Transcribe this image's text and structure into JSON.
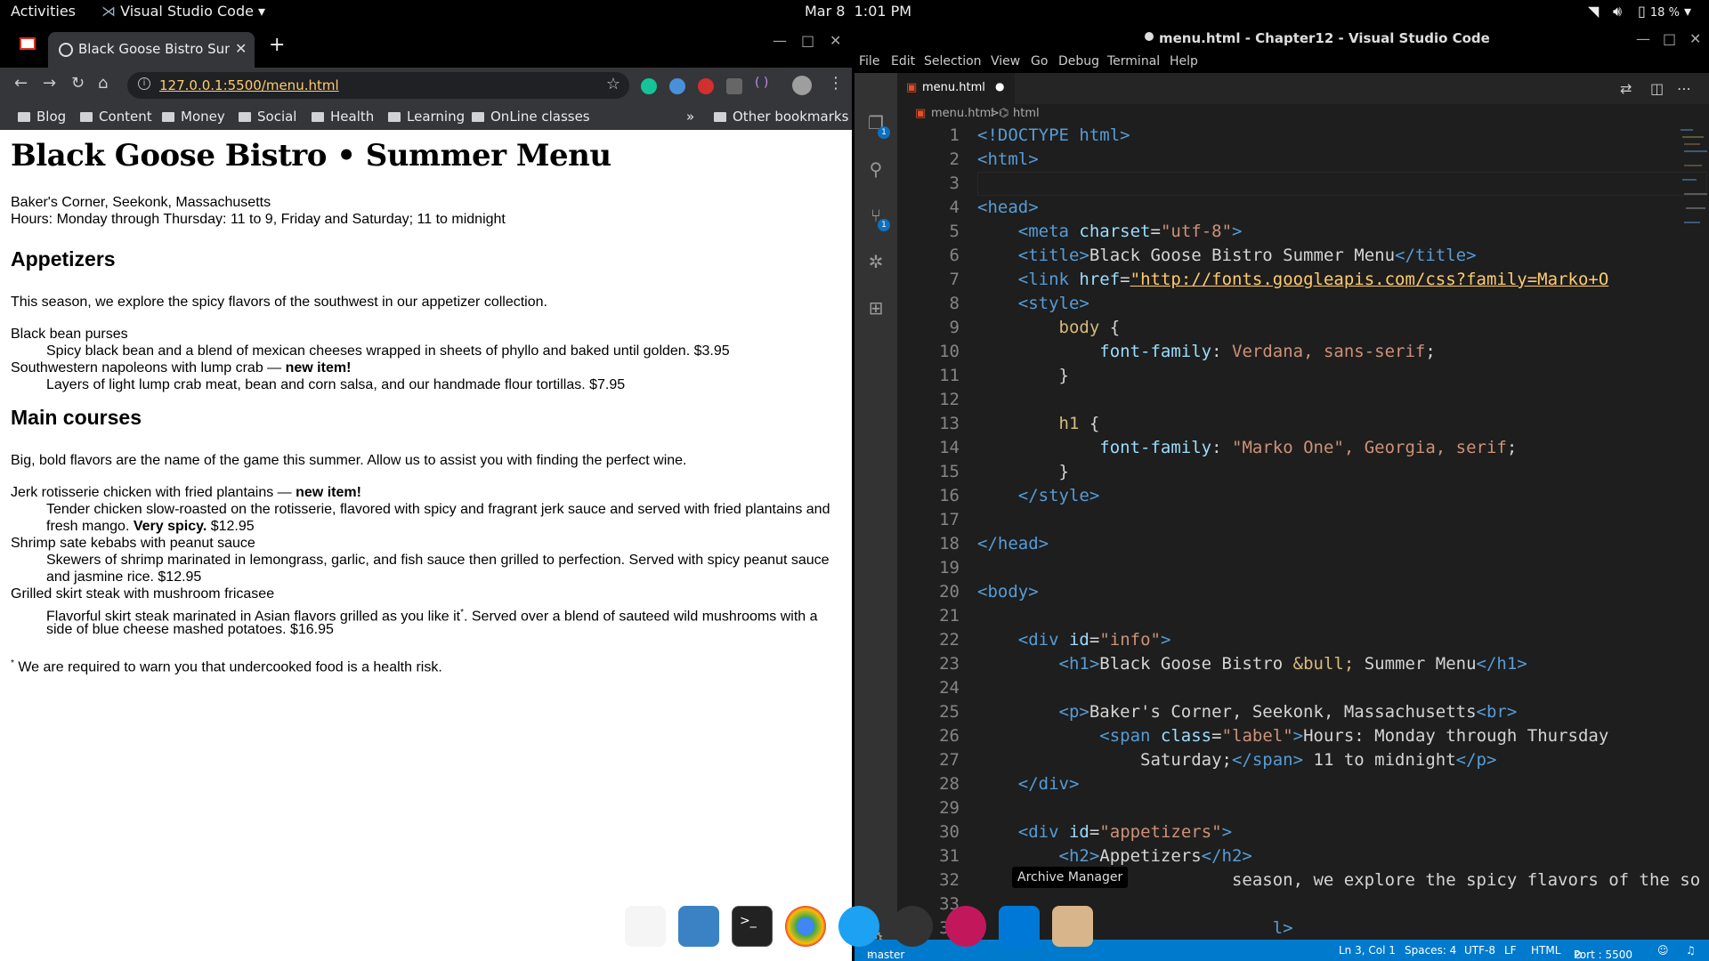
{
  "topbar": {
    "activities": "Activities",
    "app": "Visual Studio Code",
    "date": "Mar 8",
    "time": "1:01 PM",
    "battery": "18 %"
  },
  "browser": {
    "tab_title": "Black Goose Bistro Summ",
    "url": "127.0.0.1:5500/menu.html",
    "bookmarks": [
      "Blog",
      "Content",
      "Money",
      "Social",
      "Health",
      "Learning",
      "OnLine classes"
    ],
    "overflow": "»",
    "other_bookmarks": "Other bookmarks"
  },
  "page": {
    "h1": "Black Goose Bistro • Summer Menu",
    "address": "Baker's Corner, Seekonk, Massachusetts",
    "hours": "Hours: Monday through Thursday: 11 to 9, Friday and Saturday; 11 to midnight",
    "appetizers_heading": "Appetizers",
    "appetizers_intro": "This season, we explore the spicy flavors of the southwest in our appetizer collection.",
    "app1_name": "Black bean purses",
    "app1_desc": "Spicy black bean and a blend of mexican cheeses wrapped in sheets of phyllo and baked until golden. $3.95",
    "app2_name": "Southwestern napoleons with lump crab — ",
    "app2_new": "new item!",
    "app2_desc": "Layers of light lump crab meat, bean and corn salsa, and our handmade flour tortillas. $7.95",
    "main_heading": "Main courses",
    "main_intro": "Big, bold flavors are the name of the game this summer. Allow us to assist you with finding the perfect wine.",
    "main1_name": "Jerk rotisserie chicken with fried plantains — ",
    "main1_new": "new item!",
    "main1_desc1": "Tender chicken slow-roasted on the rotisserie, flavored with spicy and fragrant jerk sauce and served with fried plantains and",
    "main1_desc2a": "fresh mango. ",
    "main1_desc2b": "Very spicy.",
    "main1_desc2c": " $12.95",
    "main2_name": "Shrimp sate kebabs with peanut sauce",
    "main2_desc1": "Skewers of shrimp marinated in lemongrass, garlic, and fish sauce then grilled to perfection. Served with spicy peanut sauce",
    "main2_desc2": "and jasmine rice. $12.95",
    "main3_name": "Grilled skirt steak with mushroom fricasee",
    "main3_desc1a": "Flavorful skirt steak marinated in Asian flavors grilled as you like it",
    "main3_desc1b": "*",
    "main3_desc1c": ". Served over a blend of sauteed wild mushrooms with a",
    "main3_desc2": "side of blue cheese mashed potatoes. $16.95",
    "footnote_mark": "*",
    "footnote": " We are required to warn you that undercooked food is a health risk."
  },
  "vscode": {
    "title": "menu.html - Chapter12 - Visual Studio Code",
    "menu": [
      "File",
      "Edit",
      "Selection",
      "View",
      "Go",
      "Debug",
      "Terminal",
      "Help"
    ],
    "tab": "menu.html",
    "breadcrumb_file": "menu.html",
    "breadcrumb_sep": ">",
    "breadcrumb_node": "html",
    "badge_explorer": "1",
    "badge_scm": "1",
    "tooltip": "Archive Manager",
    "status": {
      "branch": "master",
      "position": "Ln 3, Col 1",
      "spaces": "Spaces: 4",
      "encoding": "UTF-8",
      "eol": "LF",
      "language": "HTML",
      "port": "Port : 5500"
    },
    "code_lines": [
      [
        [
          "tag",
          "<!DOCTYPE html>"
        ]
      ],
      [
        [
          "tag",
          "<html>"
        ]
      ],
      [],
      [
        [
          "tag",
          "<head>"
        ]
      ],
      [
        [
          "t",
          "    "
        ],
        [
          "tag",
          "<meta "
        ],
        [
          "attr",
          "charset"
        ],
        [
          "t",
          "="
        ],
        [
          "str",
          "\"utf-8\""
        ],
        [
          "tag",
          ">"
        ]
      ],
      [
        [
          "t",
          "    "
        ],
        [
          "tag",
          "<title>"
        ],
        [
          "t",
          "Black Goose Bistro Summer Menu"
        ],
        [
          "tag",
          "</title>"
        ]
      ],
      [
        [
          "t",
          "    "
        ],
        [
          "tag",
          "<link "
        ],
        [
          "attr",
          "href"
        ],
        [
          "t",
          "="
        ],
        [
          "url",
          "\"http://fonts.googleapis.com/css?family=Marko+O"
        ]
      ],
      [
        [
          "t",
          "    "
        ],
        [
          "tag",
          "<style>"
        ]
      ],
      [
        [
          "t",
          "        "
        ],
        [
          "sel",
          "body"
        ],
        [
          "t",
          " {"
        ]
      ],
      [
        [
          "t",
          "            "
        ],
        [
          "prop",
          "font-family"
        ],
        [
          "t",
          ": "
        ],
        [
          "str",
          "Verdana, sans-serif"
        ],
        [
          "t",
          ";"
        ]
      ],
      [
        [
          "t",
          "        }"
        ]
      ],
      [],
      [
        [
          "t",
          "        "
        ],
        [
          "sel",
          "h1"
        ],
        [
          "t",
          " {"
        ]
      ],
      [
        [
          "t",
          "            "
        ],
        [
          "prop",
          "font-family"
        ],
        [
          "t",
          ": "
        ],
        [
          "str",
          "\"Marko One\", Georgia, serif"
        ],
        [
          "t",
          ";"
        ]
      ],
      [
        [
          "t",
          "        }"
        ]
      ],
      [
        [
          "t",
          "    "
        ],
        [
          "tag",
          "</style>"
        ]
      ],
      [],
      [
        [
          "tag",
          "</head>"
        ]
      ],
      [],
      [
        [
          "tag",
          "<body>"
        ]
      ],
      [],
      [
        [
          "t",
          "    "
        ],
        [
          "tag",
          "<div "
        ],
        [
          "attr",
          "id"
        ],
        [
          "t",
          "="
        ],
        [
          "str",
          "\"info\""
        ],
        [
          "tag",
          ">"
        ]
      ],
      [
        [
          "t",
          "        "
        ],
        [
          "tag",
          "<h1>"
        ],
        [
          "t",
          "Black Goose Bistro "
        ],
        [
          "sel",
          "&bull;"
        ],
        [
          "t",
          " Summer Menu"
        ],
        [
          "tag",
          "</h1>"
        ]
      ],
      [],
      [
        [
          "t",
          "        "
        ],
        [
          "tag",
          "<p>"
        ],
        [
          "t",
          "Baker's Corner, Seekonk, Massachusetts"
        ],
        [
          "tag",
          "<br>"
        ]
      ],
      [
        [
          "t",
          "            "
        ],
        [
          "tag",
          "<span "
        ],
        [
          "attr",
          "class"
        ],
        [
          "t",
          "="
        ],
        [
          "str",
          "\"label\""
        ],
        [
          "tag",
          ">"
        ],
        [
          "t",
          "Hours: Monday through Thursday"
        ]
      ],
      [
        [
          "t",
          "                Saturday;"
        ],
        [
          "tag",
          "</span>"
        ],
        [
          "t",
          " 11 to midnight"
        ],
        [
          "tag",
          "</p>"
        ]
      ],
      [
        [
          "t",
          "    "
        ],
        [
          "tag",
          "</div>"
        ]
      ],
      [],
      [
        [
          "t",
          "    "
        ],
        [
          "tag",
          "<div "
        ],
        [
          "attr",
          "id"
        ],
        [
          "t",
          "="
        ],
        [
          "str",
          "\"appetizers\""
        ],
        [
          "tag",
          ">"
        ]
      ],
      [
        [
          "t",
          "        "
        ],
        [
          "tag",
          "<h2>"
        ],
        [
          "t",
          "Appetizers"
        ],
        [
          "tag",
          "</h2>"
        ]
      ],
      [
        [
          "t",
          "        "
        ],
        [
          "t",
          "                 season, we explore the spicy flavors of the so"
        ]
      ],
      [],
      [
        [
          "t",
          "        "
        ],
        [
          "tag",
          "                     l>"
        ]
      ]
    ]
  },
  "colors": {
    "chrome_bg": "#35363a",
    "vscode_bg": "#1e1e1e",
    "status_blue": "#007acc"
  }
}
